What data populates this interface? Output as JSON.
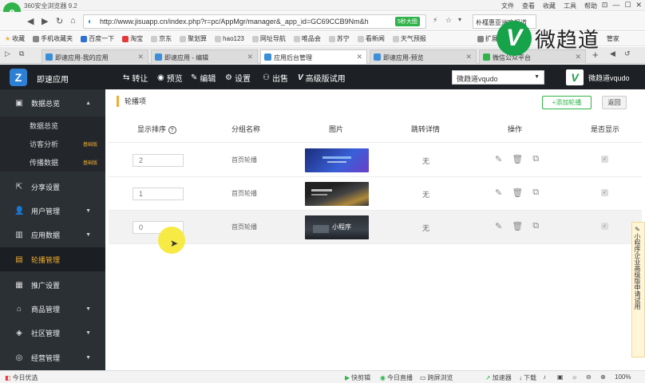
{
  "browser": {
    "title": "360安全浏览器 9.2",
    "menu": [
      "文件",
      "查看",
      "收藏",
      "工具",
      "帮助"
    ],
    "window_controls": [
      "⊡",
      "—",
      "☐",
      "✕"
    ],
    "url": "http://www.jisuapp.cn/index.php?r=pc/AppMgr/manager&_app_id=GC69CCB9Nm&h",
    "url_badge": "5秒大图",
    "search_text": "朴槿惠亚洲晚报道",
    "watermark_text": "微趋道",
    "bookmarks": [
      "收藏",
      "手机收藏夹",
      "百度一下",
      "淘宝",
      "京东",
      "聚划算",
      "hao123",
      "网址导航",
      "唯品会",
      "苏宁",
      "看新闻",
      "天气预报",
      "扩展",
      "网银",
      "管家"
    ],
    "tabs": [
      {
        "label": "即速应用-我的应用",
        "active": false
      },
      {
        "label": "即速应用 - 编辑",
        "active": false
      },
      {
        "label": "应用后台管理",
        "active": true
      },
      {
        "label": "即速应用-预览",
        "active": false
      },
      {
        "label": "微信公众平台",
        "active": false
      }
    ]
  },
  "app": {
    "name": "即速应用",
    "logo": "Z",
    "nav": [
      {
        "icon": "⇆",
        "label": "转让"
      },
      {
        "icon": "◉",
        "label": "预览"
      },
      {
        "icon": "✎",
        "label": "编辑"
      },
      {
        "icon": "⚙",
        "label": "设置"
      },
      {
        "icon": "⚇",
        "label": "出售"
      },
      {
        "icon": "V",
        "label": "高级版试用"
      }
    ],
    "app_select": "微趋道vqudo",
    "user_name": "微趋道vqudo",
    "user_avatar": "V"
  },
  "sidebar": {
    "items": [
      {
        "label": "数据总览",
        "icon": "▣",
        "caret": "▲"
      },
      {
        "label": "分享设置",
        "icon": "⇱",
        "caret": ""
      },
      {
        "label": "用户管理",
        "icon": "👤",
        "caret": "▼"
      },
      {
        "label": "应用数据",
        "icon": "▥",
        "caret": "▼"
      },
      {
        "label": "轮播管理",
        "icon": "▤",
        "caret": ""
      },
      {
        "label": "推广设置",
        "icon": "▦",
        "caret": ""
      },
      {
        "label": "商品管理",
        "icon": "⌂",
        "caret": "▼"
      },
      {
        "label": "社区管理",
        "icon": "◈",
        "caret": "▼"
      },
      {
        "label": "经营管理",
        "icon": "◎",
        "caret": "▼"
      }
    ],
    "subitems": [
      {
        "label": "数据总览",
        "badge": ""
      },
      {
        "label": "访客分析",
        "badge": "基础版"
      },
      {
        "label": "传播数据",
        "badge": "基础版"
      }
    ]
  },
  "main": {
    "title": "轮播项",
    "add_button": "+添加轮播",
    "back_button": "返回",
    "columns": [
      "显示排序",
      "分组名称",
      "图片",
      "跳转详情",
      "操作",
      "是否显示"
    ],
    "help_icon": "?",
    "rows": [
      {
        "order": "2",
        "group": "首页轮播",
        "jump": "无",
        "show": "✓"
      },
      {
        "order": "1",
        "group": "首页轮播",
        "jump": "无",
        "show": "✓"
      },
      {
        "order": "0",
        "group": "首页轮播",
        "jump": "无",
        "show": "✓"
      }
    ],
    "thumb_text": "小程序",
    "side_tab": "小程序企业高级版申请试用",
    "side_tab_icon": "✎"
  },
  "statusbar": {
    "left": "今日优选",
    "items": [
      "快剪辑",
      "今日直播",
      "跨屏浏览",
      "加速器",
      "下载",
      "100%"
    ]
  }
}
